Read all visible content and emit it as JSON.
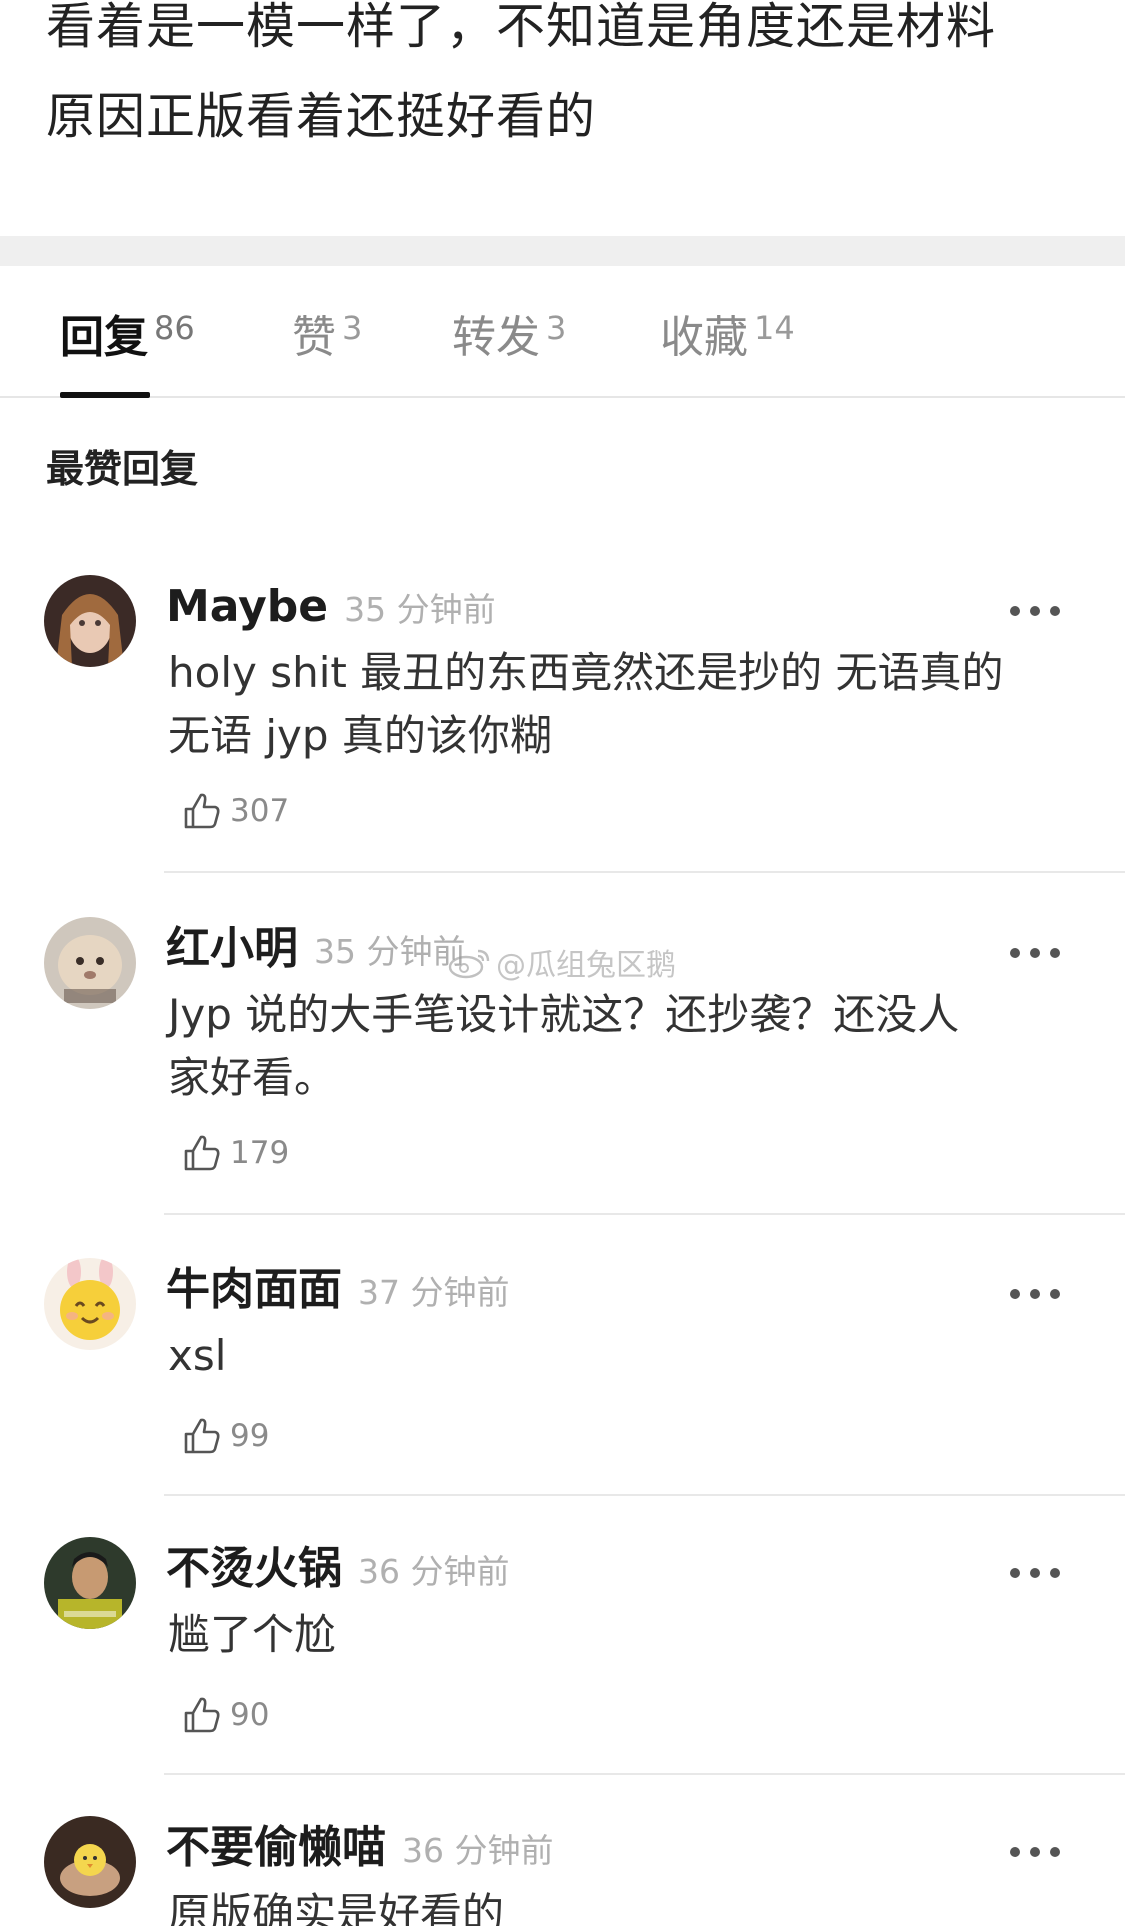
{
  "post": {
    "line1": "看着是一模一样了，不知道是角度还是材料",
    "line2": "原因正版看着还挺好看的"
  },
  "tabs": [
    {
      "label": "回复",
      "count": "86"
    },
    {
      "label": "赞",
      "count": "3"
    },
    {
      "label": "转发",
      "count": "3"
    },
    {
      "label": "收藏",
      "count": "14"
    }
  ],
  "section_title": "最赞回复",
  "comments": [
    {
      "name": "Maybe",
      "time": "35 分钟前",
      "text_line1": "holy shit 最丑的东西竟然还是抄的 无语真的",
      "text_line2": "无语 jyp 真的该你糊",
      "likes": "307"
    },
    {
      "name": "红小明",
      "time": "35 分钟前",
      "text_line1": "Jyp 说的大手笔设计就这？还抄袭？还没人",
      "text_line2": "家好看。",
      "likes": "179"
    },
    {
      "name": "牛肉面面",
      "time": "37 分钟前",
      "text_line1": "xsl",
      "text_line2": "",
      "likes": "99"
    },
    {
      "name": "不烫火锅",
      "time": "36 分钟前",
      "text_line1": "尴了个尬",
      "text_line2": "",
      "likes": "90"
    },
    {
      "name": "不要偷懒喵",
      "time": "36 分钟前",
      "text_line1": "原版确实是好看的",
      "text_line2": "",
      "likes": ""
    }
  ],
  "watermark": "@瓜组兔区鹅",
  "icons": {
    "more": "more-dots-icon",
    "like": "thumbs-up-icon",
    "weibo": "weibo-logo-icon"
  }
}
